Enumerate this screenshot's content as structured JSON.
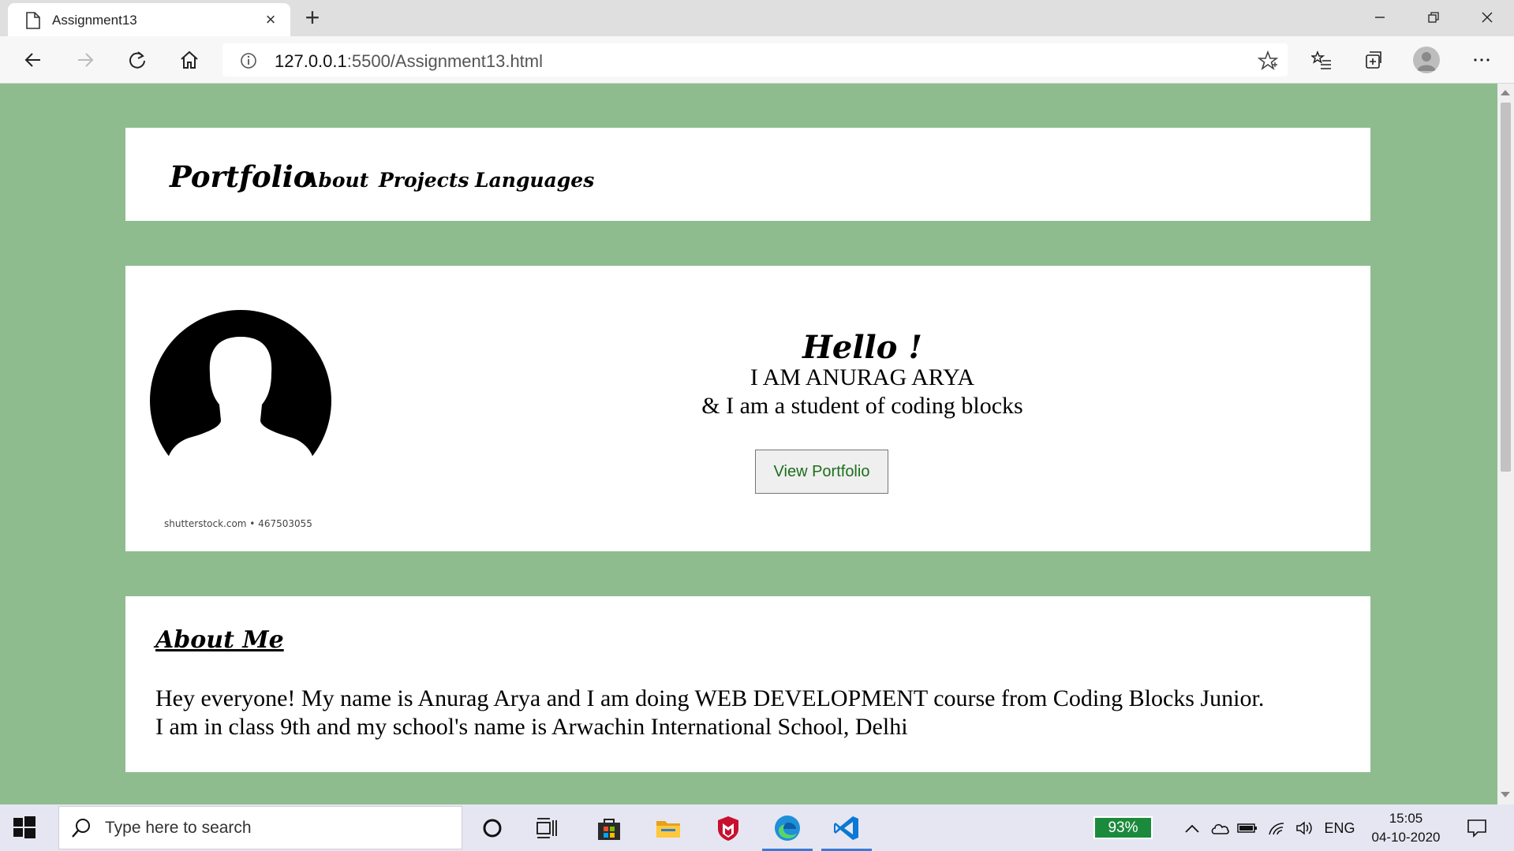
{
  "browser": {
    "tab_title": "Assignment13",
    "url_host": "127.0.0.1",
    "url_rest": ":5500/Assignment13.html"
  },
  "nav": {
    "brand": "Portfolio",
    "links": [
      "About",
      "Projects",
      "Languages"
    ]
  },
  "hero": {
    "stock_caption": "shutterstock.com • 467503055",
    "greeting": "Hello !",
    "line1": "I AM ANURAG ARYA",
    "line2": "& I am a student of coding blocks",
    "button_label": "View Portfolio"
  },
  "about": {
    "heading": "About Me",
    "line1": "Hey everyone! My name is Anurag Arya and I am doing WEB DEVELOPMENT course from Coding Blocks Junior.",
    "line2": "I am in class 9th and my school's name is Arwachin International School, Delhi"
  },
  "taskbar": {
    "search_placeholder": "Type here to search",
    "battery": "93%",
    "language": "ENG",
    "time": "15:05",
    "date": "04-10-2020"
  },
  "colors": {
    "page_background": "#8fbc8f",
    "button_text": "#1c6e1c",
    "battery": "#1c8a3c"
  }
}
